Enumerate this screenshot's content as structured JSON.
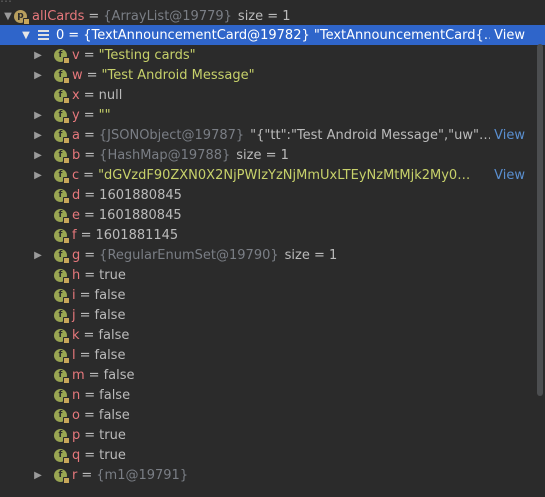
{
  "header_partial": "…",
  "root": {
    "name": "allCards",
    "ref": "{ArrayList@19779}",
    "size_label": "size = 1"
  },
  "item0": {
    "name": "0",
    "value": "{TextAnnouncementCard@19782} \"TextAnnouncementCard{…",
    "view": "View"
  },
  "fields": [
    {
      "name": "v",
      "value": "\"Testing cards\"",
      "kind": "str",
      "expandable": true
    },
    {
      "name": "w",
      "value": "\"Test Android Message\"",
      "kind": "str",
      "expandable": true
    },
    {
      "name": "x",
      "value": "null",
      "kind": "val",
      "expandable": false
    },
    {
      "name": "y",
      "value": "\"\"",
      "kind": "str",
      "expandable": true
    },
    {
      "name": "a",
      "ref": "{JSONObject@19787}",
      "value": "\"{\"tt\":\"Test Android Message\",\"uw\"…",
      "kind": "ref",
      "expandable": true,
      "view": "View"
    },
    {
      "name": "b",
      "ref": "{HashMap@19788}",
      "size_label": "size = 1",
      "kind": "refsize",
      "expandable": true
    },
    {
      "name": "c",
      "value": "\"dGVzdF90ZXN0X2NjPWIzYzNjMmUxLTEyNzMtMjk2My0…",
      "kind": "str",
      "expandable": true,
      "view": "View"
    },
    {
      "name": "d",
      "value": "1601880845",
      "kind": "val",
      "expandable": false
    },
    {
      "name": "e",
      "value": "1601880845",
      "kind": "val",
      "expandable": false
    },
    {
      "name": "f",
      "value": "1601881145",
      "kind": "val",
      "expandable": false
    },
    {
      "name": "g",
      "ref": "{RegularEnumSet@19790}",
      "size_label": "size = 1",
      "kind": "refsize",
      "expandable": true
    },
    {
      "name": "h",
      "value": "true",
      "kind": "val",
      "expandable": false
    },
    {
      "name": "i",
      "value": "false",
      "kind": "val",
      "expandable": false
    },
    {
      "name": "j",
      "value": "false",
      "kind": "val",
      "expandable": false
    },
    {
      "name": "k",
      "value": "false",
      "kind": "val",
      "expandable": false
    },
    {
      "name": "l",
      "value": "false",
      "kind": "val",
      "expandable": false
    },
    {
      "name": "m",
      "value": "false",
      "kind": "val",
      "expandable": false
    },
    {
      "name": "n",
      "value": "false",
      "kind": "val",
      "expandable": false
    },
    {
      "name": "o",
      "value": "false",
      "kind": "val",
      "expandable": false
    },
    {
      "name": "p",
      "value": "true",
      "kind": "val",
      "expandable": false
    },
    {
      "name": "q",
      "value": "true",
      "kind": "val",
      "expandable": false
    },
    {
      "name": "r",
      "ref": "{m1@19791}",
      "kind": "ref",
      "value": "",
      "expandable": true
    }
  ],
  "badge_letter_field": "f",
  "badge_letter_root": "p",
  "icons": {
    "expand": "chevron-right-icon",
    "collapse": "chevron-down-icon",
    "field": "field-badge-icon",
    "list": "list-icon"
  },
  "colors": {
    "background": "#2b2b2b",
    "selection": "#2f65ca",
    "field_name": "#e6787c",
    "string_value": "#c7d16a",
    "reference": "#7a7e85",
    "link": "#5a8fd0",
    "badge": "#9aa652"
  }
}
